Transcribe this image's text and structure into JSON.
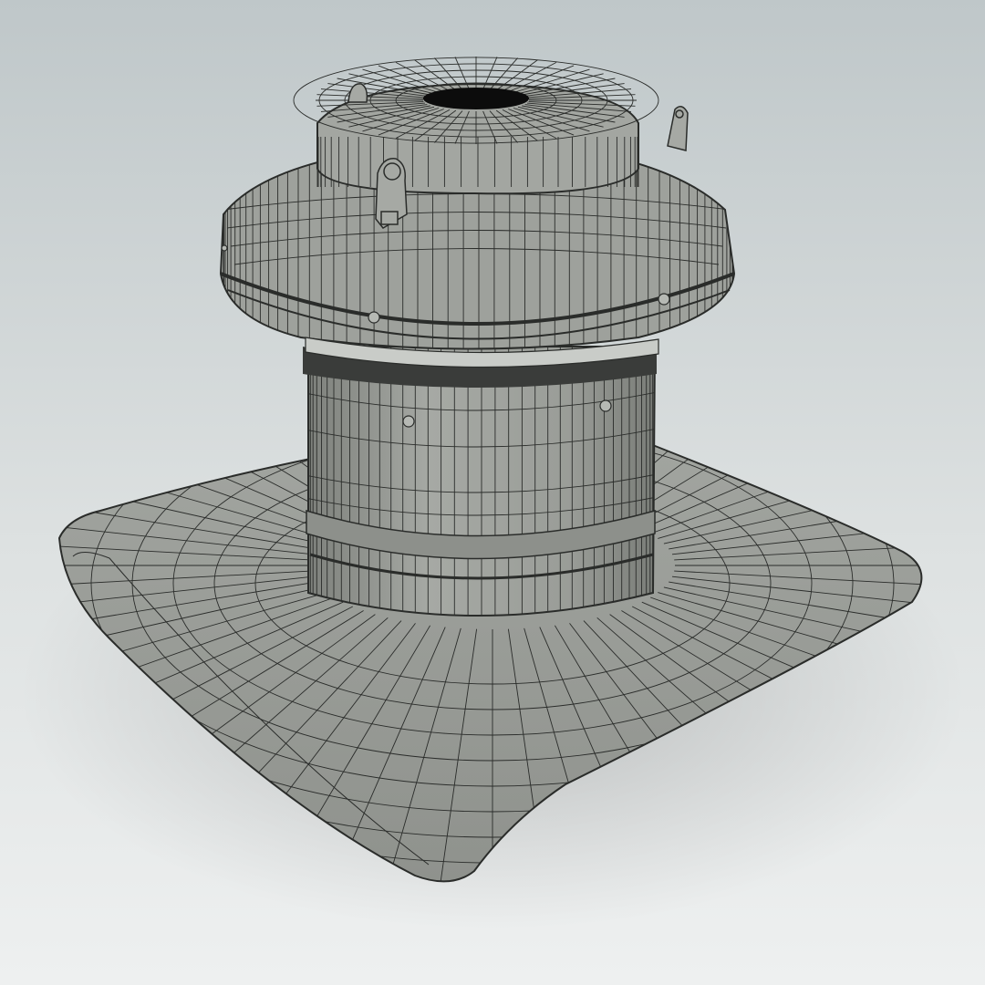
{
  "scene": {
    "subject": "rooftop-fan-wireframe-render",
    "colors": {
      "backdrop_top": "#bfc7c9",
      "backdrop_bottom": "#eef0f0",
      "surface": "#9a9d98",
      "surface_light": "#b0b3ae",
      "surface_dark": "#7f827d",
      "wire": "#2a2c2a",
      "vent_hole": "#0c0c0c"
    }
  }
}
